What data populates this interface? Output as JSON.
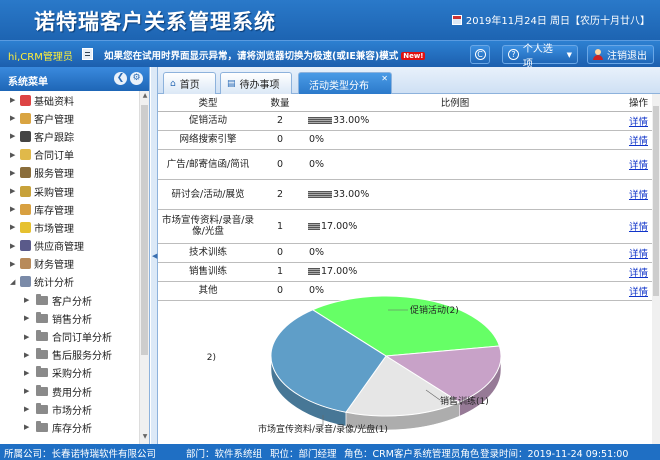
{
  "header": {
    "title": "诺特瑞客户关系管理系统",
    "date": "2019年11月24日 周日【农历十月廿八】"
  },
  "toolbar": {
    "greeting": "hi,CRM管理员",
    "notice": "如果您在试用时界面显示异常，请将浏览器切换为极速(或IE兼容)模式",
    "hot_badge": "New!",
    "personal_label": "个人选项",
    "logout_label": "注销退出"
  },
  "sidebar": {
    "title": "系统菜单",
    "items": [
      {
        "label": "基础资料",
        "color": "#d44"
      },
      {
        "label": "客户管理",
        "color": "#d9a441"
      },
      {
        "label": "客户跟踪",
        "color": "#444"
      },
      {
        "label": "合同订单",
        "color": "#e0b94a"
      },
      {
        "label": "服务管理",
        "color": "#8a6d3b"
      },
      {
        "label": "采购管理",
        "color": "#c8a23a"
      },
      {
        "label": "库存管理",
        "color": "#d8a040"
      },
      {
        "label": "市场管理",
        "color": "#e6c12f"
      },
      {
        "label": "供应商管理",
        "color": "#5a5a8a"
      },
      {
        "label": "财务管理",
        "color": "#b88a5a"
      },
      {
        "label": "统计分析",
        "color": "#7a8aa8"
      }
    ],
    "subitems": [
      "客户分析",
      "销售分析",
      "合同订单分析",
      "售后服务分析",
      "采购分析",
      "费用分析",
      "市场分析",
      "库存分析"
    ]
  },
  "tabs": [
    {
      "label": "首页"
    },
    {
      "label": "待办事项"
    },
    {
      "label": "活动类型分布"
    }
  ],
  "table": {
    "headers": {
      "type": "类型",
      "count": "数量",
      "ratio": "比例图",
      "op": "操作"
    },
    "detail_label": "详情",
    "rows": [
      {
        "type": "促销活动",
        "count": "2",
        "pct": "33.00%",
        "pct_value": 33
      },
      {
        "type": "网络搜索引擎",
        "count": "0",
        "pct": "0%",
        "pct_value": 0
      },
      {
        "type": "广告/邮寄信函/简讯",
        "count": "0",
        "pct": "0%",
        "pct_value": 0
      },
      {
        "type": "研讨会/活动/展览",
        "count": "2",
        "pct": "33.00%",
        "pct_value": 33
      },
      {
        "type": "市场宣传资料/录音/录像/光盘",
        "count": "1",
        "pct": "17.00%",
        "pct_value": 17
      },
      {
        "type": "技术训练",
        "count": "0",
        "pct": "0%",
        "pct_value": 0
      },
      {
        "type": "销售训练",
        "count": "1",
        "pct": "17.00%",
        "pct_value": 17
      },
      {
        "type": "其他",
        "count": "0",
        "pct": "0%",
        "pct_value": 0
      }
    ]
  },
  "chart_data": {
    "type": "pie",
    "title": "",
    "slices": [
      {
        "label": "促销活动(2)",
        "value": 2,
        "color": "#66ff66"
      },
      {
        "label": "销售训练(1)",
        "value": 1,
        "color": "#c8a2c8"
      },
      {
        "label": "市场宣传资料/录音/录像/光盘(1)",
        "value": 1,
        "color": "#e6e6e6"
      },
      {
        "label": "2)",
        "value": 2,
        "color": "#5f9ec8"
      }
    ]
  },
  "footer": {
    "company": "所属公司：长春诺特瑞软件有限公司",
    "dept": "部门：软件系统组",
    "position": "职位：部门经理",
    "role": "角色：CRM客户系统管理员角色",
    "login_time": "登录时间：2019-11-24 09:51:00"
  }
}
